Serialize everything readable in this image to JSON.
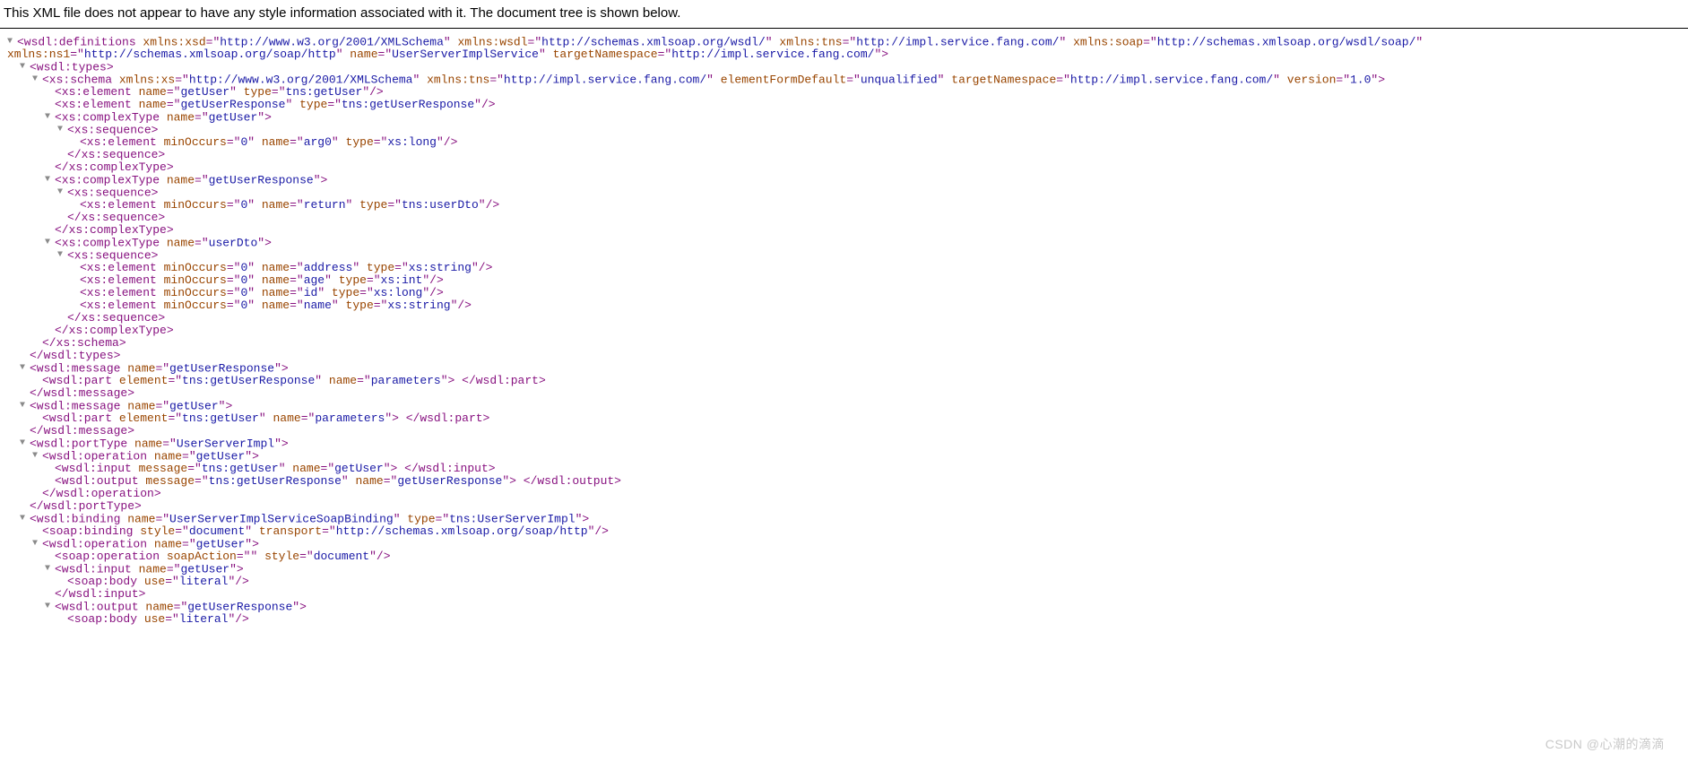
{
  "header": "This XML file does not appear to have any style information associated with it. The document tree is shown below.",
  "watermark": "CSDN @心潮的滴滴",
  "lines": [
    {
      "i": 0,
      "t": true,
      "p": [
        [
          "pu",
          "<wsdl:definitions"
        ],
        [
          "an",
          " xmlns:xsd"
        ],
        [
          "pu",
          "=\""
        ],
        [
          "av",
          "http://www.w3.org/2001/XMLSchema"
        ],
        [
          "pu",
          "\""
        ],
        [
          "an",
          " xmlns:wsdl"
        ],
        [
          "pu",
          "=\""
        ],
        [
          "av",
          "http://schemas.xmlsoap.org/wsdl/"
        ],
        [
          "pu",
          "\""
        ],
        [
          "an",
          " xmlns:tns"
        ],
        [
          "pu",
          "=\""
        ],
        [
          "av",
          "http://impl.service.fang.com/"
        ],
        [
          "pu",
          "\""
        ],
        [
          "an",
          " xmlns:soap"
        ],
        [
          "pu",
          "=\""
        ],
        [
          "av",
          "http://schemas.xmlsoap.org/wsdl/soap/"
        ],
        [
          "pu",
          "\""
        ]
      ]
    },
    {
      "i": 0,
      "t": false,
      "cont": true,
      "p": [
        [
          "an",
          "xmlns:ns1"
        ],
        [
          "pu",
          "=\""
        ],
        [
          "av",
          "http://schemas.xmlsoap.org/soap/http"
        ],
        [
          "pu",
          "\""
        ],
        [
          "an",
          " name"
        ],
        [
          "pu",
          "=\""
        ],
        [
          "av",
          "UserServerImplService"
        ],
        [
          "pu",
          "\""
        ],
        [
          "an",
          " targetNamespace"
        ],
        [
          "pu",
          "=\""
        ],
        [
          "av",
          "http://impl.service.fang.com/"
        ],
        [
          "pu",
          "\">"
        ]
      ]
    },
    {
      "i": 1,
      "t": true,
      "p": [
        [
          "pu",
          "<wsdl:types>"
        ]
      ]
    },
    {
      "i": 2,
      "t": true,
      "p": [
        [
          "pu",
          "<xs:schema"
        ],
        [
          "an",
          " xmlns:xs"
        ],
        [
          "pu",
          "=\""
        ],
        [
          "av",
          "http://www.w3.org/2001/XMLSchema"
        ],
        [
          "pu",
          "\""
        ],
        [
          "an",
          " xmlns:tns"
        ],
        [
          "pu",
          "=\""
        ],
        [
          "av",
          "http://impl.service.fang.com/"
        ],
        [
          "pu",
          "\""
        ],
        [
          "an",
          " elementFormDefault"
        ],
        [
          "pu",
          "=\""
        ],
        [
          "av",
          "unqualified"
        ],
        [
          "pu",
          "\""
        ],
        [
          "an",
          " targetNamespace"
        ],
        [
          "pu",
          "=\""
        ],
        [
          "av",
          "http://impl.service.fang.com/"
        ],
        [
          "pu",
          "\""
        ],
        [
          "an",
          " version"
        ],
        [
          "pu",
          "=\""
        ],
        [
          "av",
          "1.0"
        ],
        [
          "pu",
          "\">"
        ]
      ]
    },
    {
      "i": 3,
      "t": false,
      "p": [
        [
          "pu",
          "<xs:element"
        ],
        [
          "an",
          " name"
        ],
        [
          "pu",
          "=\""
        ],
        [
          "av",
          "getUser"
        ],
        [
          "pu",
          "\""
        ],
        [
          "an",
          " type"
        ],
        [
          "pu",
          "=\""
        ],
        [
          "av",
          "tns:getUser"
        ],
        [
          "pu",
          "\"/>"
        ]
      ]
    },
    {
      "i": 3,
      "t": false,
      "p": [
        [
          "pu",
          "<xs:element"
        ],
        [
          "an",
          " name"
        ],
        [
          "pu",
          "=\""
        ],
        [
          "av",
          "getUserResponse"
        ],
        [
          "pu",
          "\""
        ],
        [
          "an",
          " type"
        ],
        [
          "pu",
          "=\""
        ],
        [
          "av",
          "tns:getUserResponse"
        ],
        [
          "pu",
          "\"/>"
        ]
      ]
    },
    {
      "i": 3,
      "t": true,
      "p": [
        [
          "pu",
          "<xs:complexType"
        ],
        [
          "an",
          " name"
        ],
        [
          "pu",
          "=\""
        ],
        [
          "av",
          "getUser"
        ],
        [
          "pu",
          "\">"
        ]
      ]
    },
    {
      "i": 4,
      "t": true,
      "p": [
        [
          "pu",
          "<xs:sequence>"
        ]
      ]
    },
    {
      "i": 5,
      "t": false,
      "p": [
        [
          "pu",
          "<xs:element"
        ],
        [
          "an",
          " minOccurs"
        ],
        [
          "pu",
          "=\""
        ],
        [
          "av",
          "0"
        ],
        [
          "pu",
          "\""
        ],
        [
          "an",
          " name"
        ],
        [
          "pu",
          "=\""
        ],
        [
          "av",
          "arg0"
        ],
        [
          "pu",
          "\""
        ],
        [
          "an",
          " type"
        ],
        [
          "pu",
          "=\""
        ],
        [
          "av",
          "xs:long"
        ],
        [
          "pu",
          "\"/>"
        ]
      ]
    },
    {
      "i": 4,
      "t": false,
      "p": [
        [
          "pu",
          "</xs:sequence>"
        ]
      ]
    },
    {
      "i": 3,
      "t": false,
      "p": [
        [
          "pu",
          "</xs:complexType>"
        ]
      ]
    },
    {
      "i": 3,
      "t": true,
      "p": [
        [
          "pu",
          "<xs:complexType"
        ],
        [
          "an",
          " name"
        ],
        [
          "pu",
          "=\""
        ],
        [
          "av",
          "getUserResponse"
        ],
        [
          "pu",
          "\">"
        ]
      ]
    },
    {
      "i": 4,
      "t": true,
      "p": [
        [
          "pu",
          "<xs:sequence>"
        ]
      ]
    },
    {
      "i": 5,
      "t": false,
      "p": [
        [
          "pu",
          "<xs:element"
        ],
        [
          "an",
          " minOccurs"
        ],
        [
          "pu",
          "=\""
        ],
        [
          "av",
          "0"
        ],
        [
          "pu",
          "\""
        ],
        [
          "an",
          " name"
        ],
        [
          "pu",
          "=\""
        ],
        [
          "av",
          "return"
        ],
        [
          "pu",
          "\""
        ],
        [
          "an",
          " type"
        ],
        [
          "pu",
          "=\""
        ],
        [
          "av",
          "tns:userDto"
        ],
        [
          "pu",
          "\"/>"
        ]
      ]
    },
    {
      "i": 4,
      "t": false,
      "p": [
        [
          "pu",
          "</xs:sequence>"
        ]
      ]
    },
    {
      "i": 3,
      "t": false,
      "p": [
        [
          "pu",
          "</xs:complexType>"
        ]
      ]
    },
    {
      "i": 3,
      "t": true,
      "p": [
        [
          "pu",
          "<xs:complexType"
        ],
        [
          "an",
          " name"
        ],
        [
          "pu",
          "=\""
        ],
        [
          "av",
          "userDto"
        ],
        [
          "pu",
          "\">"
        ]
      ]
    },
    {
      "i": 4,
      "t": true,
      "p": [
        [
          "pu",
          "<xs:sequence>"
        ]
      ]
    },
    {
      "i": 5,
      "t": false,
      "p": [
        [
          "pu",
          "<xs:element"
        ],
        [
          "an",
          " minOccurs"
        ],
        [
          "pu",
          "=\""
        ],
        [
          "av",
          "0"
        ],
        [
          "pu",
          "\""
        ],
        [
          "an",
          " name"
        ],
        [
          "pu",
          "=\""
        ],
        [
          "av",
          "address"
        ],
        [
          "pu",
          "\""
        ],
        [
          "an",
          " type"
        ],
        [
          "pu",
          "=\""
        ],
        [
          "av",
          "xs:string"
        ],
        [
          "pu",
          "\"/>"
        ]
      ]
    },
    {
      "i": 5,
      "t": false,
      "p": [
        [
          "pu",
          "<xs:element"
        ],
        [
          "an",
          " minOccurs"
        ],
        [
          "pu",
          "=\""
        ],
        [
          "av",
          "0"
        ],
        [
          "pu",
          "\""
        ],
        [
          "an",
          " name"
        ],
        [
          "pu",
          "=\""
        ],
        [
          "av",
          "age"
        ],
        [
          "pu",
          "\""
        ],
        [
          "an",
          " type"
        ],
        [
          "pu",
          "=\""
        ],
        [
          "av",
          "xs:int"
        ],
        [
          "pu",
          "\"/>"
        ]
      ]
    },
    {
      "i": 5,
      "t": false,
      "p": [
        [
          "pu",
          "<xs:element"
        ],
        [
          "an",
          " minOccurs"
        ],
        [
          "pu",
          "=\""
        ],
        [
          "av",
          "0"
        ],
        [
          "pu",
          "\""
        ],
        [
          "an",
          " name"
        ],
        [
          "pu",
          "=\""
        ],
        [
          "av",
          "id"
        ],
        [
          "pu",
          "\""
        ],
        [
          "an",
          " type"
        ],
        [
          "pu",
          "=\""
        ],
        [
          "av",
          "xs:long"
        ],
        [
          "pu",
          "\"/>"
        ]
      ]
    },
    {
      "i": 5,
      "t": false,
      "p": [
        [
          "pu",
          "<xs:element"
        ],
        [
          "an",
          " minOccurs"
        ],
        [
          "pu",
          "=\""
        ],
        [
          "av",
          "0"
        ],
        [
          "pu",
          "\""
        ],
        [
          "an",
          " name"
        ],
        [
          "pu",
          "=\""
        ],
        [
          "av",
          "name"
        ],
        [
          "pu",
          "\""
        ],
        [
          "an",
          " type"
        ],
        [
          "pu",
          "=\""
        ],
        [
          "av",
          "xs:string"
        ],
        [
          "pu",
          "\"/>"
        ]
      ]
    },
    {
      "i": 4,
      "t": false,
      "p": [
        [
          "pu",
          "</xs:sequence>"
        ]
      ]
    },
    {
      "i": 3,
      "t": false,
      "p": [
        [
          "pu",
          "</xs:complexType>"
        ]
      ]
    },
    {
      "i": 2,
      "t": false,
      "p": [
        [
          "pu",
          "</xs:schema>"
        ]
      ]
    },
    {
      "i": 1,
      "t": false,
      "p": [
        [
          "pu",
          "</wsdl:types>"
        ]
      ]
    },
    {
      "i": 1,
      "t": true,
      "p": [
        [
          "pu",
          "<wsdl:message"
        ],
        [
          "an",
          " name"
        ],
        [
          "pu",
          "=\""
        ],
        [
          "av",
          "getUserResponse"
        ],
        [
          "pu",
          "\">"
        ]
      ]
    },
    {
      "i": 2,
      "t": false,
      "p": [
        [
          "pu",
          "<wsdl:part"
        ],
        [
          "an",
          " element"
        ],
        [
          "pu",
          "=\""
        ],
        [
          "av",
          "tns:getUserResponse"
        ],
        [
          "pu",
          "\""
        ],
        [
          "an",
          " name"
        ],
        [
          "pu",
          "=\""
        ],
        [
          "av",
          "parameters"
        ],
        [
          "pu",
          "\"> </wsdl:part>"
        ]
      ]
    },
    {
      "i": 1,
      "t": false,
      "p": [
        [
          "pu",
          "</wsdl:message>"
        ]
      ]
    },
    {
      "i": 1,
      "t": true,
      "p": [
        [
          "pu",
          "<wsdl:message"
        ],
        [
          "an",
          " name"
        ],
        [
          "pu",
          "=\""
        ],
        [
          "av",
          "getUser"
        ],
        [
          "pu",
          "\">"
        ]
      ]
    },
    {
      "i": 2,
      "t": false,
      "p": [
        [
          "pu",
          "<wsdl:part"
        ],
        [
          "an",
          " element"
        ],
        [
          "pu",
          "=\""
        ],
        [
          "av",
          "tns:getUser"
        ],
        [
          "pu",
          "\""
        ],
        [
          "an",
          " name"
        ],
        [
          "pu",
          "=\""
        ],
        [
          "av",
          "parameters"
        ],
        [
          "pu",
          "\"> </wsdl:part>"
        ]
      ]
    },
    {
      "i": 1,
      "t": false,
      "p": [
        [
          "pu",
          "</wsdl:message>"
        ]
      ]
    },
    {
      "i": 1,
      "t": true,
      "p": [
        [
          "pu",
          "<wsdl:portType"
        ],
        [
          "an",
          " name"
        ],
        [
          "pu",
          "=\""
        ],
        [
          "av",
          "UserServerImpl"
        ],
        [
          "pu",
          "\">"
        ]
      ]
    },
    {
      "i": 2,
      "t": true,
      "p": [
        [
          "pu",
          "<wsdl:operation"
        ],
        [
          "an",
          " name"
        ],
        [
          "pu",
          "=\""
        ],
        [
          "av",
          "getUser"
        ],
        [
          "pu",
          "\">"
        ]
      ]
    },
    {
      "i": 3,
      "t": false,
      "p": [
        [
          "pu",
          "<wsdl:input"
        ],
        [
          "an",
          " message"
        ],
        [
          "pu",
          "=\""
        ],
        [
          "av",
          "tns:getUser"
        ],
        [
          "pu",
          "\""
        ],
        [
          "an",
          " name"
        ],
        [
          "pu",
          "=\""
        ],
        [
          "av",
          "getUser"
        ],
        [
          "pu",
          "\"> </wsdl:input>"
        ]
      ]
    },
    {
      "i": 3,
      "t": false,
      "p": [
        [
          "pu",
          "<wsdl:output"
        ],
        [
          "an",
          " message"
        ],
        [
          "pu",
          "=\""
        ],
        [
          "av",
          "tns:getUserResponse"
        ],
        [
          "pu",
          "\""
        ],
        [
          "an",
          " name"
        ],
        [
          "pu",
          "=\""
        ],
        [
          "av",
          "getUserResponse"
        ],
        [
          "pu",
          "\"> </wsdl:output>"
        ]
      ]
    },
    {
      "i": 2,
      "t": false,
      "p": [
        [
          "pu",
          "</wsdl:operation>"
        ]
      ]
    },
    {
      "i": 1,
      "t": false,
      "p": [
        [
          "pu",
          "</wsdl:portType>"
        ]
      ]
    },
    {
      "i": 1,
      "t": true,
      "p": [
        [
          "pu",
          "<wsdl:binding"
        ],
        [
          "an",
          " name"
        ],
        [
          "pu",
          "=\""
        ],
        [
          "av",
          "UserServerImplServiceSoapBinding"
        ],
        [
          "pu",
          "\""
        ],
        [
          "an",
          " type"
        ],
        [
          "pu",
          "=\""
        ],
        [
          "av",
          "tns:UserServerImpl"
        ],
        [
          "pu",
          "\">"
        ]
      ]
    },
    {
      "i": 2,
      "t": false,
      "p": [
        [
          "pu",
          "<soap:binding"
        ],
        [
          "an",
          " style"
        ],
        [
          "pu",
          "=\""
        ],
        [
          "av",
          "document"
        ],
        [
          "pu",
          "\""
        ],
        [
          "an",
          " transport"
        ],
        [
          "pu",
          "=\""
        ],
        [
          "av",
          "http://schemas.xmlsoap.org/soap/http"
        ],
        [
          "pu",
          "\"/>"
        ]
      ]
    },
    {
      "i": 2,
      "t": true,
      "p": [
        [
          "pu",
          "<wsdl:operation"
        ],
        [
          "an",
          " name"
        ],
        [
          "pu",
          "=\""
        ],
        [
          "av",
          "getUser"
        ],
        [
          "pu",
          "\">"
        ]
      ]
    },
    {
      "i": 3,
      "t": false,
      "p": [
        [
          "pu",
          "<soap:operation"
        ],
        [
          "an",
          " soapAction"
        ],
        [
          "pu",
          "=\""
        ],
        [
          "av",
          ""
        ],
        [
          "pu",
          "\""
        ],
        [
          "an",
          " style"
        ],
        [
          "pu",
          "=\""
        ],
        [
          "av",
          "document"
        ],
        [
          "pu",
          "\"/>"
        ]
      ]
    },
    {
      "i": 3,
      "t": true,
      "p": [
        [
          "pu",
          "<wsdl:input"
        ],
        [
          "an",
          " name"
        ],
        [
          "pu",
          "=\""
        ],
        [
          "av",
          "getUser"
        ],
        [
          "pu",
          "\">"
        ]
      ]
    },
    {
      "i": 4,
      "t": false,
      "p": [
        [
          "pu",
          "<soap:body"
        ],
        [
          "an",
          " use"
        ],
        [
          "pu",
          "=\""
        ],
        [
          "av",
          "literal"
        ],
        [
          "pu",
          "\"/>"
        ]
      ]
    },
    {
      "i": 3,
      "t": false,
      "p": [
        [
          "pu",
          "</wsdl:input>"
        ]
      ]
    },
    {
      "i": 3,
      "t": true,
      "p": [
        [
          "pu",
          "<wsdl:output"
        ],
        [
          "an",
          " name"
        ],
        [
          "pu",
          "=\""
        ],
        [
          "av",
          "getUserResponse"
        ],
        [
          "pu",
          "\">"
        ]
      ]
    },
    {
      "i": 4,
      "t": false,
      "p": [
        [
          "pu",
          "<soap:body"
        ],
        [
          "an",
          " use"
        ],
        [
          "pu",
          "=\""
        ],
        [
          "av",
          "literal"
        ],
        [
          "pu",
          "\"/>"
        ]
      ]
    }
  ]
}
